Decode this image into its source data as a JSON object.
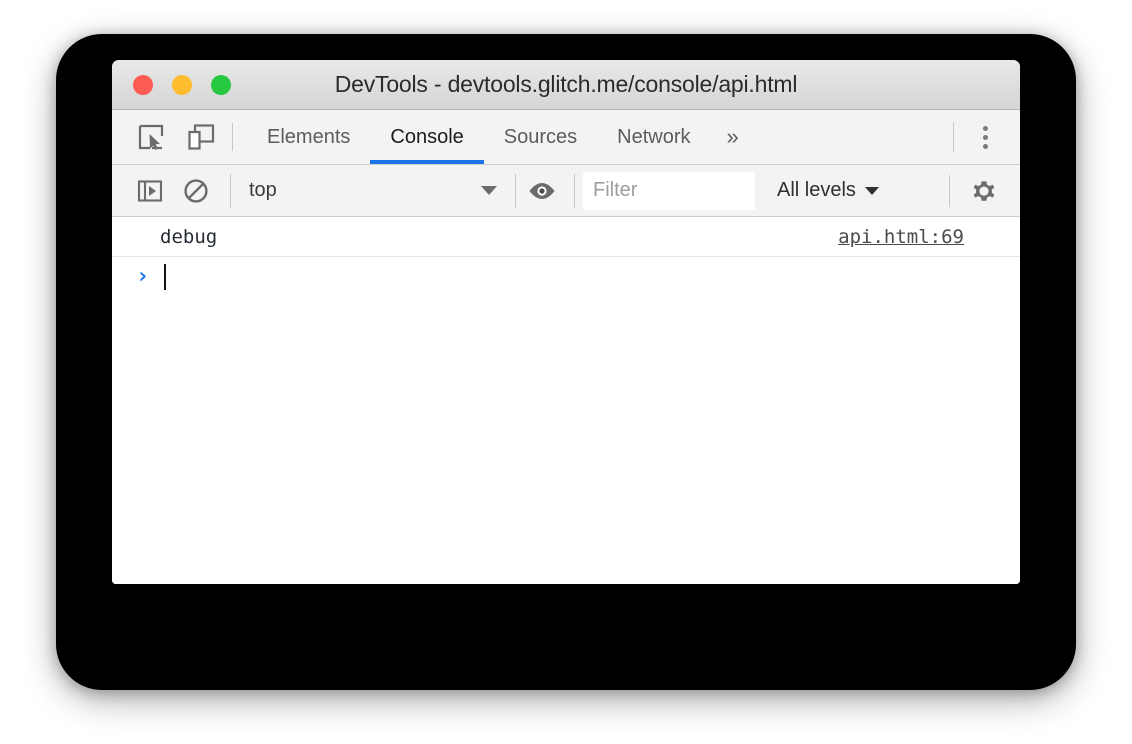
{
  "window": {
    "title": "DevTools - devtools.glitch.me/console/api.html",
    "traffic_lights": [
      {
        "name": "close",
        "color": "#fc5b54"
      },
      {
        "name": "minimize",
        "color": "#febd2e"
      },
      {
        "name": "zoom",
        "color": "#27c83f"
      }
    ]
  },
  "tabbar": {
    "inspect_icon": "inspect-element-icon",
    "device_icon": "device-toolbar-icon",
    "tabs": [
      {
        "label": "Elements",
        "active": false
      },
      {
        "label": "Console",
        "active": true
      },
      {
        "label": "Sources",
        "active": false
      },
      {
        "label": "Network",
        "active": false
      }
    ],
    "overflow_label": "»",
    "menu_icon": "kebab-menu-icon",
    "active_accent": "#1a73e8"
  },
  "console_toolbar": {
    "sidebar_toggle_icon": "console-sidebar-icon",
    "clear_icon": "clear-console-icon",
    "context": {
      "value": "top",
      "caret": "chevron-down-icon"
    },
    "eye_icon": "live-expression-eye-icon",
    "filter": {
      "value": "",
      "placeholder": "Filter"
    },
    "levels": {
      "label": "All levels",
      "caret": "chevron-down-icon"
    },
    "settings_icon": "settings-gear-icon"
  },
  "console": {
    "messages": [
      {
        "text": "debug",
        "source": "api.html:69"
      }
    ],
    "prompt": {
      "arrow": "›",
      "input_value": ""
    }
  }
}
